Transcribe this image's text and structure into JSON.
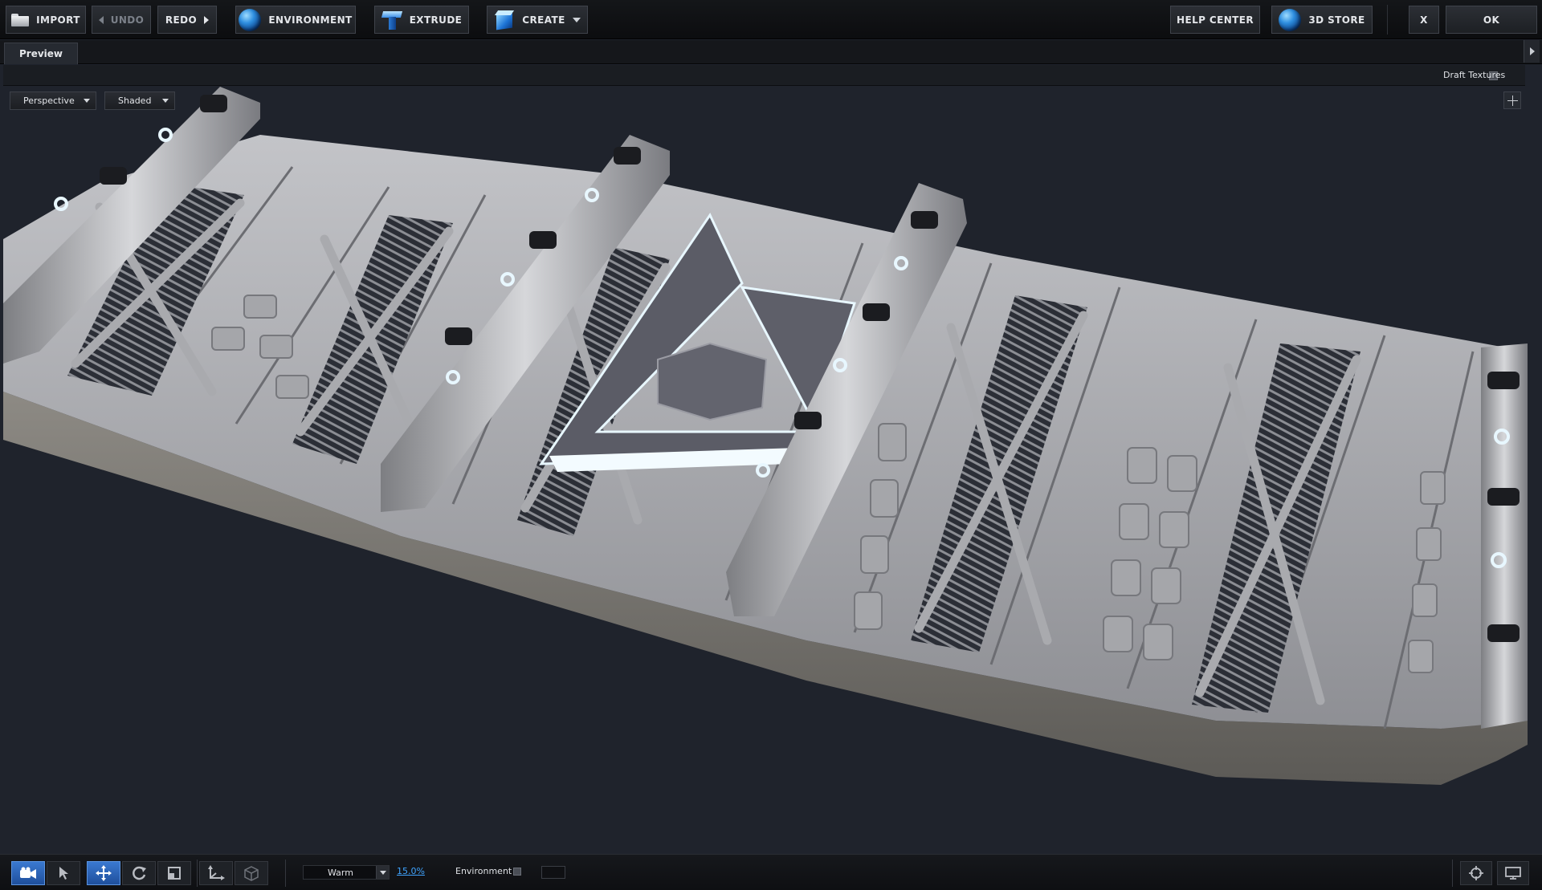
{
  "toolbar": {
    "import": "IMPORT",
    "undo": "UNDO",
    "redo": "REDO",
    "environment": "ENVIRONMENT",
    "extrude": "EXTRUDE",
    "create": "CREATE",
    "help_center": "HELP CENTER",
    "store": "3D STORE",
    "close": "X",
    "ok": "OK"
  },
  "tabs": {
    "preview": "Preview"
  },
  "options": {
    "draft_textures": "Draft Textures",
    "draft_textures_checked": false
  },
  "viewport": {
    "camera": "Perspective",
    "shading": "Shaded"
  },
  "bottom": {
    "light_preset": "Warm",
    "intensity": "15.0%",
    "environment_label": "Environment",
    "environment_checked": false
  },
  "colors": {
    "viewport_bg": "#1f232c",
    "accent": "#3a79d0",
    "link": "#3fa4ff",
    "model": "#b7b8bc",
    "glow": "#e8f7ff"
  },
  "icons": {
    "import": "folder-icon",
    "environment": "globe-icon",
    "extrude": "extrude-t-icon",
    "create": "cube-icon",
    "store": "globe-icon",
    "tools": [
      "camera-icon",
      "select-arrow-icon",
      "move-icon",
      "rotate-icon",
      "scale-icon",
      "axis-icon",
      "object-cube-icon"
    ]
  }
}
